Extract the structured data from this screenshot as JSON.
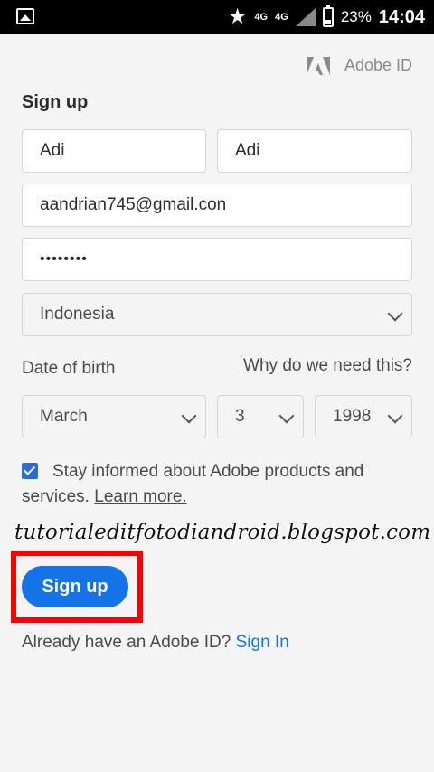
{
  "status_bar": {
    "network_1": "4G",
    "network_2": "4G",
    "battery_pct": "23%",
    "time": "14:04",
    "icons": [
      "image-icon",
      "star-icon",
      "signal-icon",
      "battery-icon"
    ]
  },
  "brand": {
    "label": "Adobe ID",
    "icon": "adobe-logo-icon",
    "color": "#8a8a8a"
  },
  "form": {
    "title": "Sign up",
    "first_name": "Adi",
    "last_name": "Adi",
    "email": "aandrian745@gmail.con",
    "password_mask": "••••••••",
    "country": "Indonesia",
    "dob_label": "Date of birth",
    "why_link": "Why do we need this?",
    "dob_month": "March",
    "dob_day": "3",
    "dob_year": "1998",
    "consent_text": "Stay informed about Adobe products and services.",
    "consent_link": "Learn more.",
    "consent_checked": true,
    "submit_label": "Sign up",
    "accent_color": "#1473e6"
  },
  "overlay": {
    "watermark": "tutorialeditfotodiandroid.blogspot.com",
    "highlight_color": "#ff0000"
  },
  "footer": {
    "prompt": "Already have an Adobe ID?",
    "signin_link": "Sign In"
  }
}
